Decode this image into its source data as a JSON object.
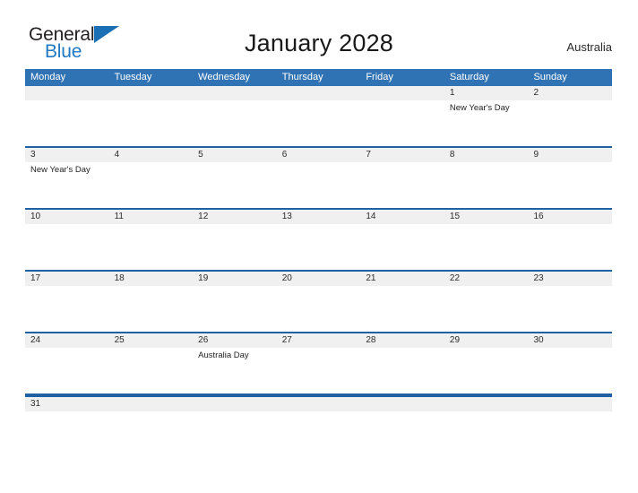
{
  "brand": {
    "name_part1": "General",
    "name_part2": "Blue",
    "triangle_icon": "triangle-logo-icon",
    "colors": {
      "dark": "#231f20",
      "blue": "#2079c3",
      "triangle": "#1b6fb5"
    }
  },
  "header": {
    "title": "January 2028",
    "region": "Australia"
  },
  "colors": {
    "header_blue": "#3073b4",
    "separator_blue": "#1f62a4",
    "number_band": "#f0f0f0",
    "text_dark": "#1f1f1f"
  },
  "calendar": {
    "month": "January",
    "year": "2028",
    "weekdays": [
      "Monday",
      "Tuesday",
      "Wednesday",
      "Thursday",
      "Friday",
      "Saturday",
      "Sunday"
    ],
    "weeks": [
      {
        "days": [
          {
            "num": "",
            "event": ""
          },
          {
            "num": "",
            "event": ""
          },
          {
            "num": "",
            "event": ""
          },
          {
            "num": "",
            "event": ""
          },
          {
            "num": "",
            "event": ""
          },
          {
            "num": "1",
            "event": "New Year's Day"
          },
          {
            "num": "2",
            "event": ""
          }
        ]
      },
      {
        "days": [
          {
            "num": "3",
            "event": "New Year's Day"
          },
          {
            "num": "4",
            "event": ""
          },
          {
            "num": "5",
            "event": ""
          },
          {
            "num": "6",
            "event": ""
          },
          {
            "num": "7",
            "event": ""
          },
          {
            "num": "8",
            "event": ""
          },
          {
            "num": "9",
            "event": ""
          }
        ]
      },
      {
        "days": [
          {
            "num": "10",
            "event": ""
          },
          {
            "num": "11",
            "event": ""
          },
          {
            "num": "12",
            "event": ""
          },
          {
            "num": "13",
            "event": ""
          },
          {
            "num": "14",
            "event": ""
          },
          {
            "num": "15",
            "event": ""
          },
          {
            "num": "16",
            "event": ""
          }
        ]
      },
      {
        "days": [
          {
            "num": "17",
            "event": ""
          },
          {
            "num": "18",
            "event": ""
          },
          {
            "num": "19",
            "event": ""
          },
          {
            "num": "20",
            "event": ""
          },
          {
            "num": "21",
            "event": ""
          },
          {
            "num": "22",
            "event": ""
          },
          {
            "num": "23",
            "event": ""
          }
        ]
      },
      {
        "days": [
          {
            "num": "24",
            "event": ""
          },
          {
            "num": "25",
            "event": ""
          },
          {
            "num": "26",
            "event": "Australia Day"
          },
          {
            "num": "27",
            "event": ""
          },
          {
            "num": "28",
            "event": ""
          },
          {
            "num": "29",
            "event": ""
          },
          {
            "num": "30",
            "event": ""
          }
        ]
      },
      {
        "days": [
          {
            "num": "31",
            "event": ""
          },
          {
            "num": "",
            "event": ""
          },
          {
            "num": "",
            "event": ""
          },
          {
            "num": "",
            "event": ""
          },
          {
            "num": "",
            "event": ""
          },
          {
            "num": "",
            "event": ""
          },
          {
            "num": "",
            "event": ""
          }
        ]
      }
    ]
  }
}
